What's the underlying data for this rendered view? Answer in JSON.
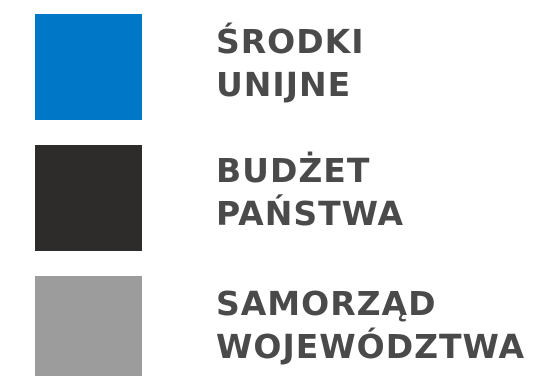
{
  "legend": {
    "text_color": "#4a4a4a",
    "items": [
      {
        "line1": "ŚRODKI",
        "line2": "UNIJNE",
        "color": "#0078c8"
      },
      {
        "line1": "BUDŻET",
        "line2": "PAŃSTWA",
        "color": "#2e2c2b"
      },
      {
        "line1": "SAMORZĄD",
        "line2": "WOJEWÓDZTWA",
        "color": "#9c9c9c"
      }
    ]
  }
}
